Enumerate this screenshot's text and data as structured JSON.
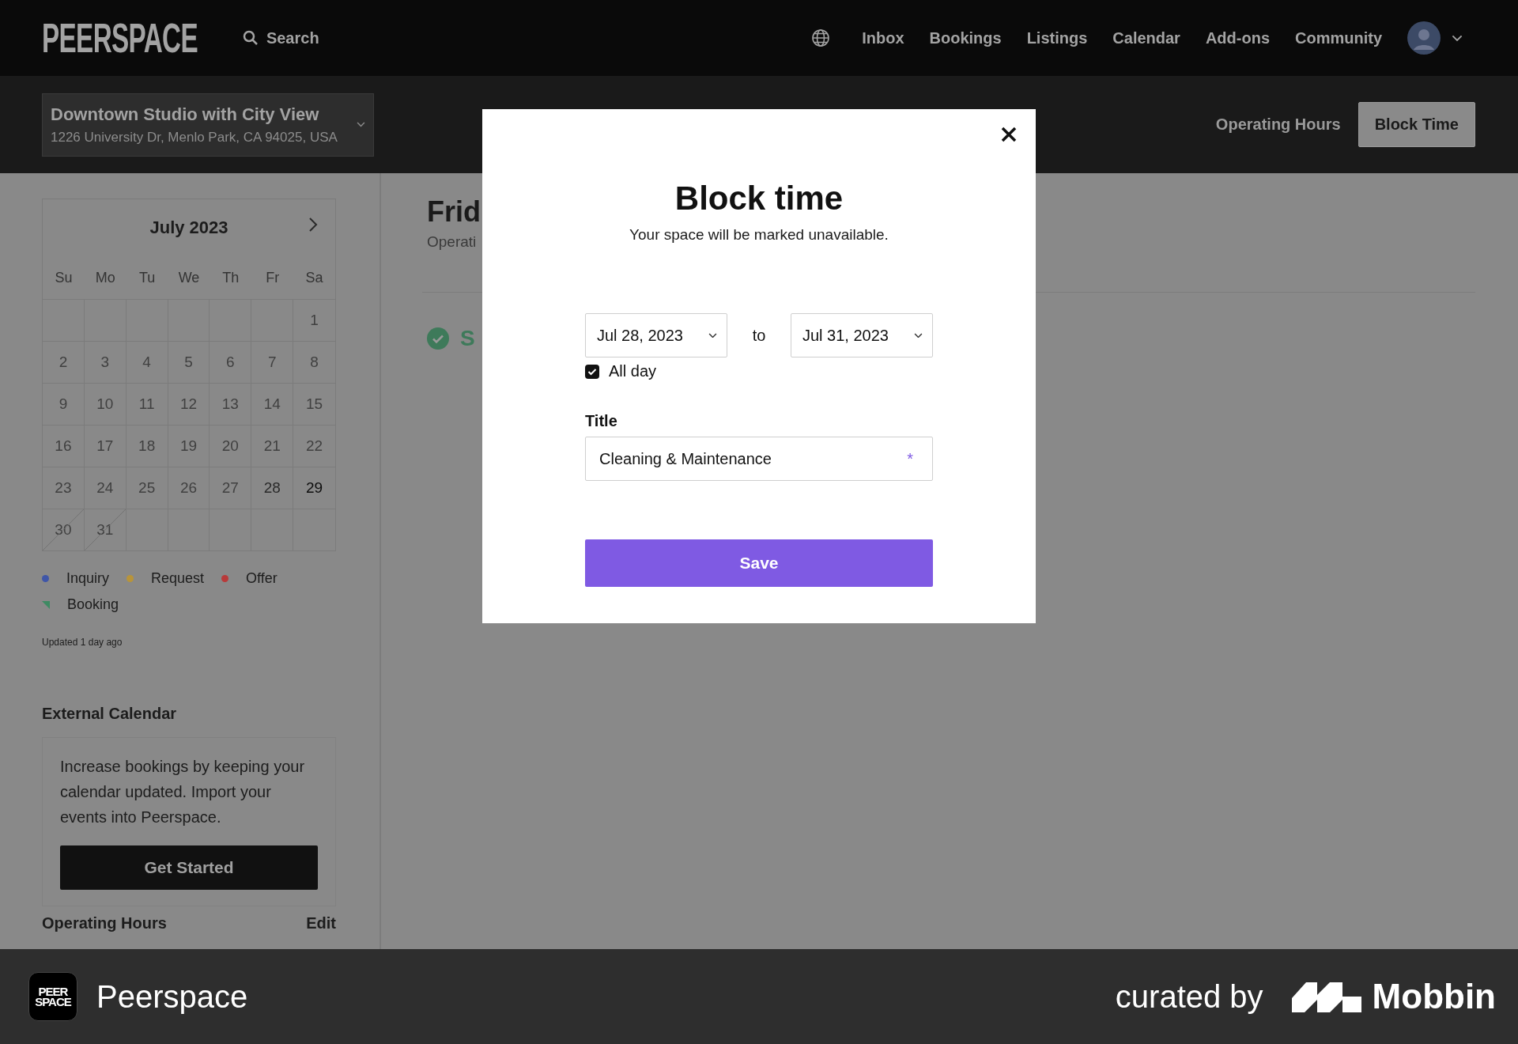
{
  "nav": {
    "logo": "PEERSPACE",
    "search": "Search",
    "links": [
      "Inbox",
      "Bookings",
      "Listings",
      "Calendar",
      "Add-ons",
      "Community"
    ]
  },
  "listing": {
    "title": "Downtown Studio with City View",
    "address": "1226 University Dr, Menlo Park, CA 94025, USA"
  },
  "header_actions": {
    "link": "Operating Hours",
    "button": "Block Time"
  },
  "calendar": {
    "month": "July 2023",
    "weekdays": [
      "Su",
      "Mo",
      "Tu",
      "We",
      "Th",
      "Fr",
      "Sa"
    ],
    "weeks": [
      [
        {
          "kind": "empty"
        },
        {
          "kind": "empty"
        },
        {
          "kind": "empty"
        },
        {
          "kind": "empty"
        },
        {
          "kind": "empty"
        },
        {
          "kind": "empty"
        },
        {
          "day": "1",
          "kind": "past"
        }
      ],
      [
        {
          "day": "2",
          "kind": "past"
        },
        {
          "day": "3",
          "kind": "past"
        },
        {
          "day": "4",
          "kind": "past"
        },
        {
          "day": "5",
          "kind": "past"
        },
        {
          "day": "6",
          "kind": "past"
        },
        {
          "day": "7",
          "kind": "past"
        },
        {
          "day": "8",
          "kind": "past"
        }
      ],
      [
        {
          "day": "9",
          "kind": "past"
        },
        {
          "day": "10",
          "kind": "past"
        },
        {
          "day": "11",
          "kind": "past"
        },
        {
          "day": "12",
          "kind": "past"
        },
        {
          "day": "13",
          "kind": "past"
        },
        {
          "day": "14",
          "kind": "past"
        },
        {
          "day": "15",
          "kind": "past"
        }
      ],
      [
        {
          "day": "16",
          "kind": "past"
        },
        {
          "day": "17",
          "kind": "past"
        },
        {
          "day": "18",
          "kind": "past"
        },
        {
          "day": "19",
          "kind": "past"
        },
        {
          "day": "20",
          "kind": "past"
        },
        {
          "day": "21",
          "kind": "past"
        },
        {
          "day": "22",
          "kind": "past"
        }
      ],
      [
        {
          "day": "23",
          "kind": "past"
        },
        {
          "day": "24",
          "kind": "past"
        },
        {
          "day": "25",
          "kind": "past"
        },
        {
          "day": "26",
          "kind": "past"
        },
        {
          "day": "27",
          "kind": "past"
        },
        {
          "day": "28",
          "kind": "upcoming"
        },
        {
          "day": "29",
          "kind": "today"
        }
      ],
      [
        {
          "day": "30",
          "kind": "blocked"
        },
        {
          "day": "31",
          "kind": "blocked"
        },
        {
          "kind": "empty"
        },
        {
          "kind": "empty"
        },
        {
          "kind": "empty"
        },
        {
          "kind": "empty"
        },
        {
          "kind": "empty"
        }
      ]
    ]
  },
  "legend": [
    {
      "label": "Inquiry",
      "color": "#3f56a8",
      "kind": "dot"
    },
    {
      "label": "Request",
      "color": "#b8943a",
      "kind": "dot"
    },
    {
      "label": "Offer",
      "color": "#b83a3a",
      "kind": "dot"
    },
    {
      "label": "Booking",
      "color": "#3e8a63",
      "kind": "flag"
    }
  ],
  "updated": "Updated 1 day ago",
  "external_calendar": {
    "heading": "External Calendar",
    "text": "Increase bookings by keeping your calendar updated. Import your events into Peerspace.",
    "button": "Get Started"
  },
  "operating_hours": {
    "heading": "Operating Hours",
    "action": "Edit"
  },
  "main": {
    "day_title": "Frid",
    "subtitle": "Operati",
    "status": "S"
  },
  "modal": {
    "title": "Block time",
    "subtitle": "Your space will be marked unavailable.",
    "start_date": "Jul 28, 2023",
    "separator": "to",
    "end_date": "Jul 31, 2023",
    "all_day": {
      "label": "All day",
      "checked": true
    },
    "title_label": "Title",
    "title_value": "Cleaning & Maintenance",
    "required_mark": "*",
    "save": "Save"
  },
  "footer": {
    "app_icon_lines": [
      "PEER",
      "SPACE"
    ],
    "app_name": "Peerspace",
    "curated_by": "curated by",
    "brand": "Mobbin"
  }
}
